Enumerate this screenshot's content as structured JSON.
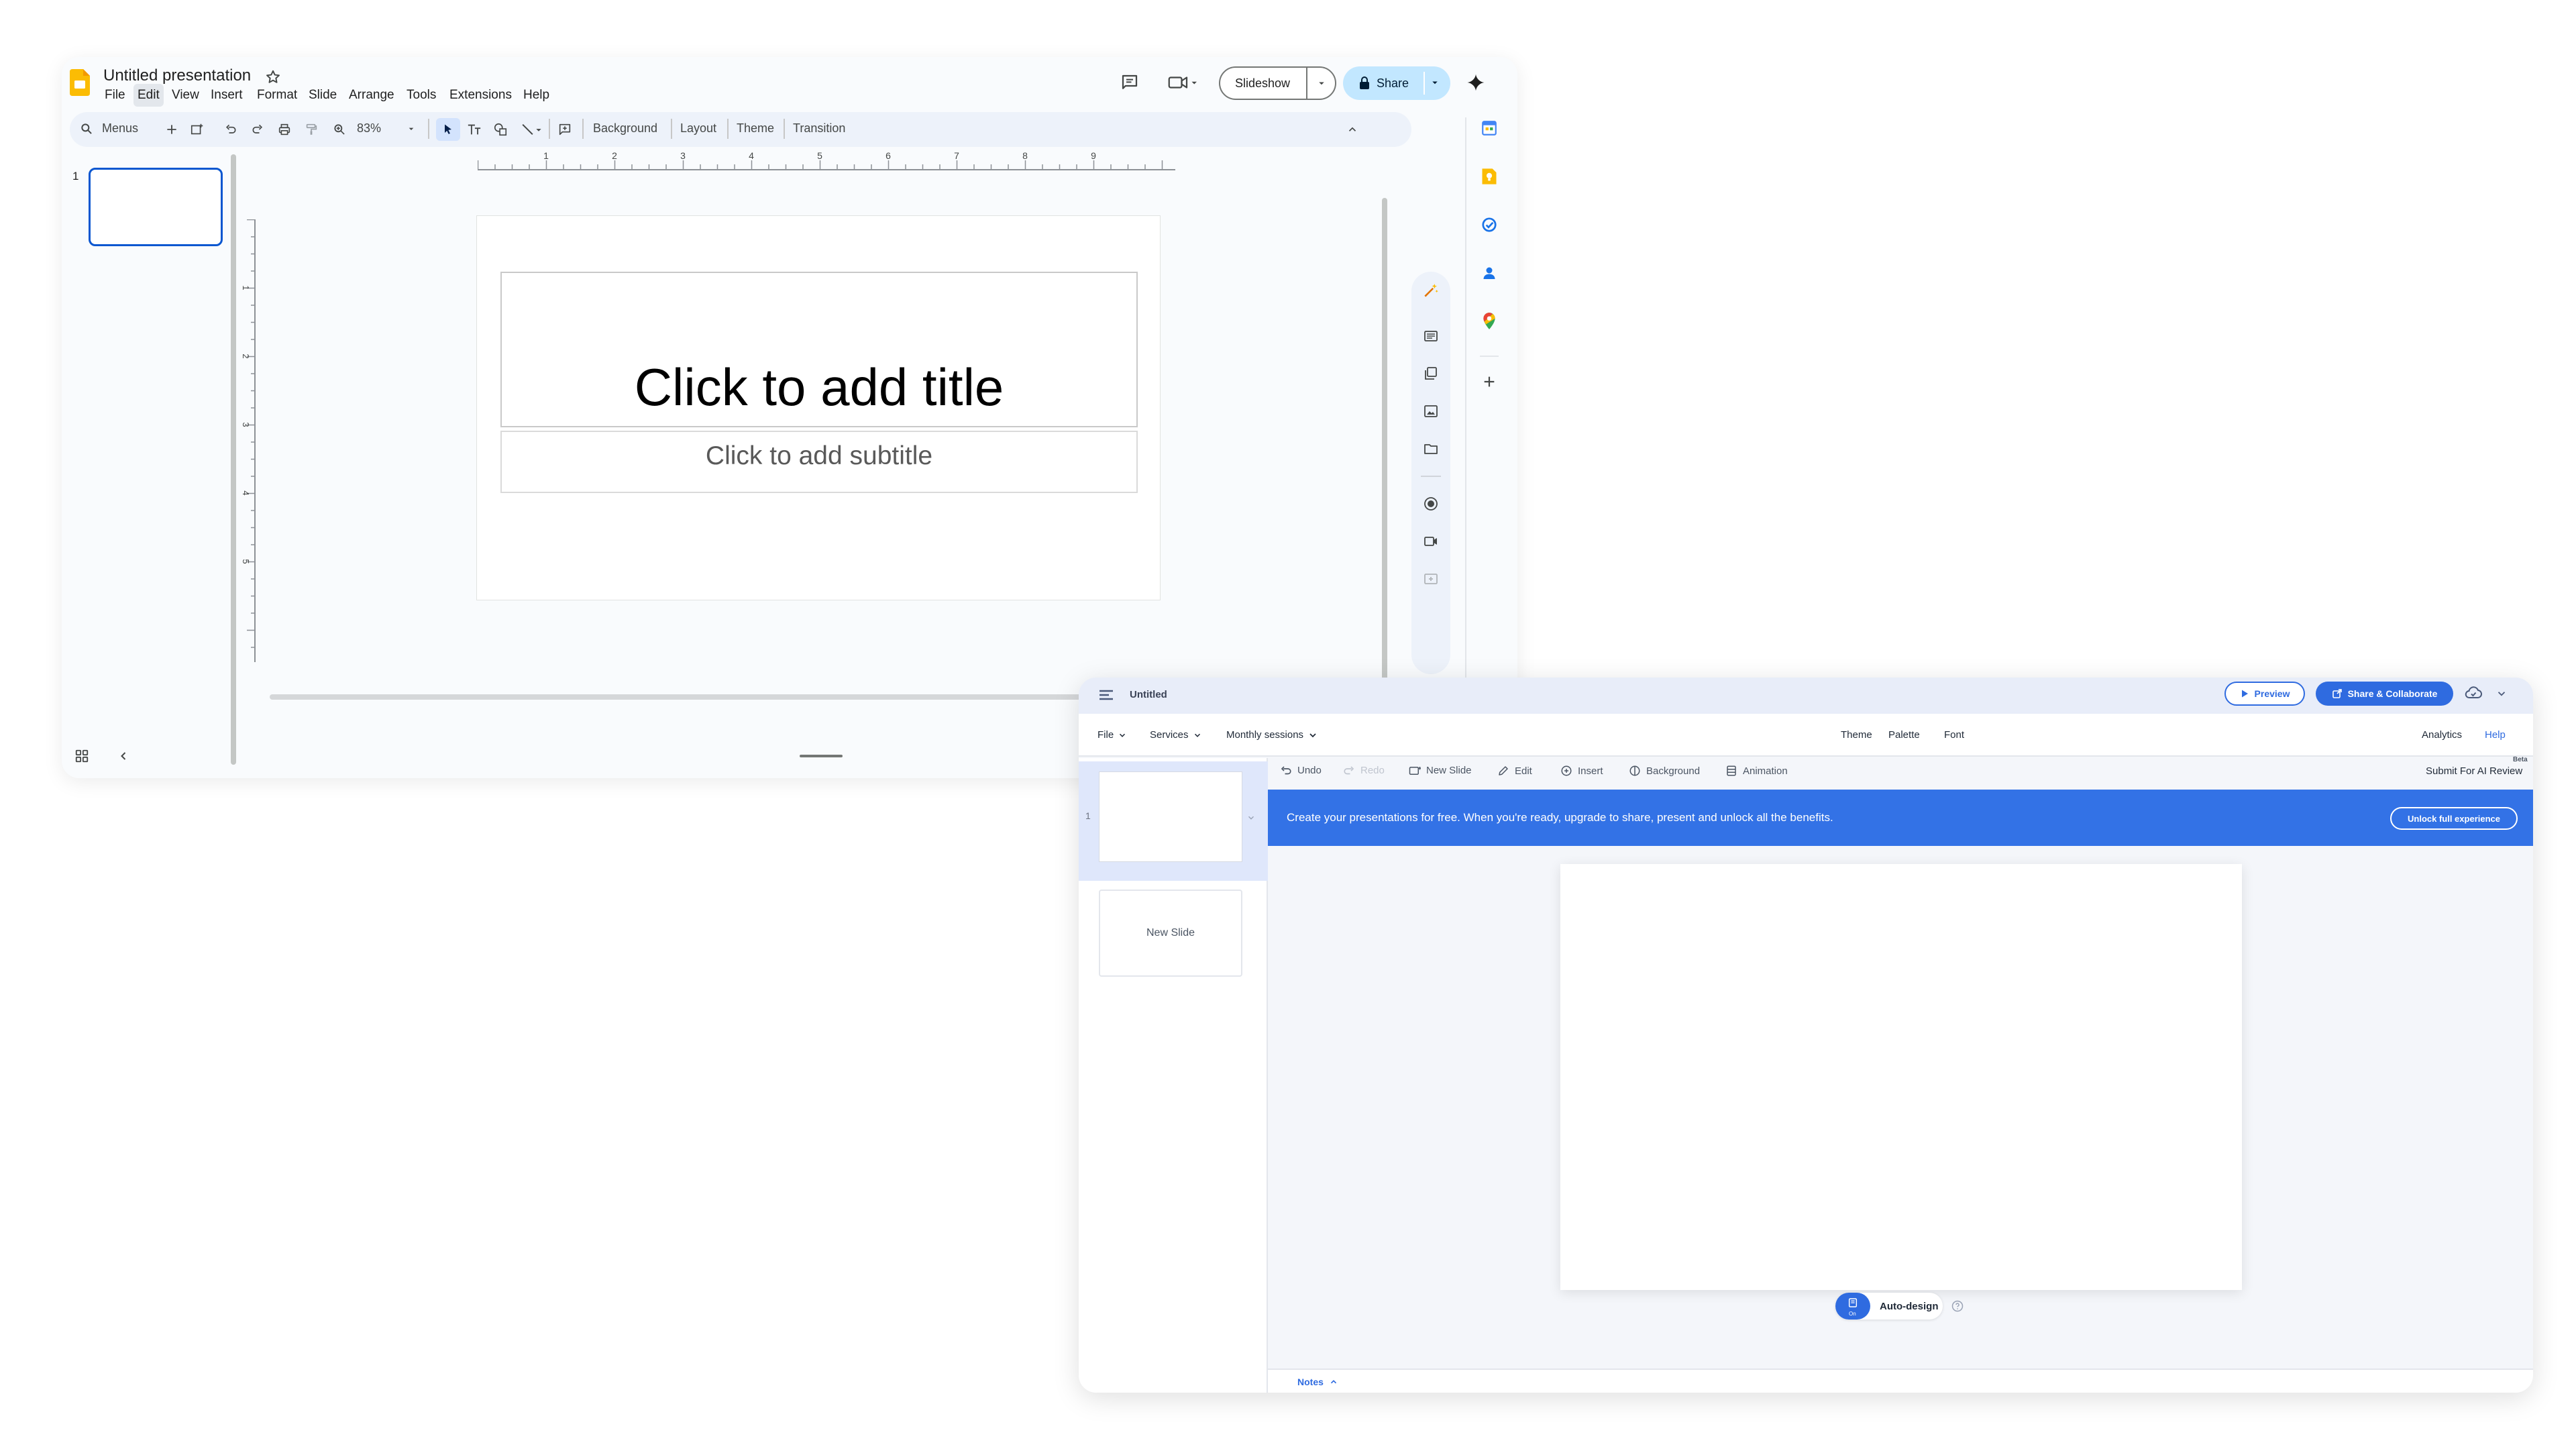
{
  "slides_app": {
    "title": "Untitled presentation",
    "menus": [
      "File",
      "Edit",
      "View",
      "Insert",
      "Format",
      "Slide",
      "Arrange",
      "Tools",
      "Extensions",
      "Help"
    ],
    "toolbar": {
      "search_label": "Menus",
      "zoom": "83%",
      "background": "Background",
      "layout": "Layout",
      "theme": "Theme",
      "transition": "Transition"
    },
    "slideshow_label": "Slideshow",
    "share_label": "Share",
    "ruler_numbers": [
      "1",
      "2",
      "3",
      "4",
      "5",
      "6",
      "7",
      "8",
      "9"
    ],
    "vertical_ruler_numbers": [
      "1",
      "2",
      "3",
      "4",
      "5"
    ],
    "slide_number": "1",
    "title_placeholder": "Click to add title",
    "subtitle_placeholder": "Click to add subtitle",
    "colors": {
      "accent": "#0b57d0",
      "share_bg": "#c2e7ff",
      "toolbar_bg": "#edf2fa",
      "app_icon": "#fbbc04"
    }
  },
  "editor_app": {
    "doc_title": "Untitled",
    "preview_label": "Preview",
    "share_collab_label": "Share & Collaborate",
    "menus": {
      "file": "File",
      "services": "Services",
      "monthly_sessions": "Monthly sessions",
      "theme": "Theme",
      "palette": "Palette",
      "font": "Font",
      "analytics": "Analytics",
      "help": "Help"
    },
    "tools": {
      "undo": "Undo",
      "redo": "Redo",
      "new_slide": "New Slide",
      "edit": "Edit",
      "insert": "Insert",
      "background": "Background",
      "animation": "Animation"
    },
    "beta_label": "Beta",
    "submit_label": "Submit For AI Review",
    "banner_text": "Create your presentations for free. When you're ready, upgrade to share, present and unlock all the benefits.",
    "banner_button": "Unlock full experience",
    "slide_number": "1",
    "new_slide_card": "New Slide",
    "auto_design_state": "On",
    "auto_design_label": "Auto-design",
    "notes_label": "Notes",
    "colors": {
      "primary": "#2f6be0",
      "banner": "#3372e6",
      "topbar": "#e8edf9"
    }
  }
}
